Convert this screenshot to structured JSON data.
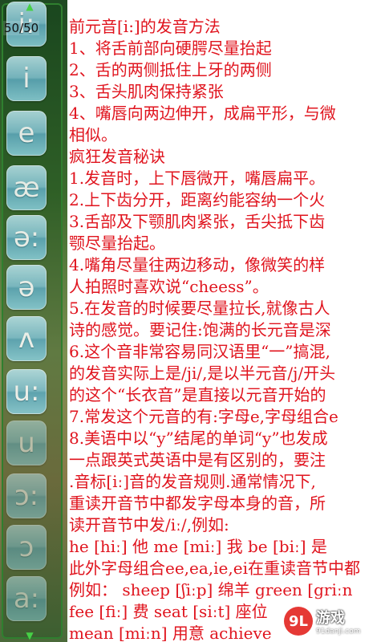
{
  "rail": {
    "counter": "50/50",
    "symbols": [
      "i:",
      "i",
      "e",
      "æ",
      "ə:",
      "ə",
      "ʌ",
      "u:",
      "u",
      "ɔ:",
      "ɔ",
      "a:"
    ]
  },
  "content": {
    "lines": [
      "前元音[i:]的发音方法",
      "1、将舌前部向硬腭尽量抬起",
      "2、舌的两侧抵住上牙的两侧",
      "3、舌头肌肉保持紧张",
      "4、嘴唇向两边伸开，成扁平形，与微",
      "相似。",
      "疯狂发音秘诀",
      "1.发音时，上下唇微开，嘴唇扁平。",
      "2.上下齿分开，距离约能容纳一个火",
      "3.舌部及下颚肌肉紧张，舌尖抵下齿",
      "颚尽量抬起。",
      "4.嘴角尽量往两边移动，像微笑的样",
      "人拍照时喜欢说“cheess”。",
      "5.在发音的时候要尽量拉长,就像古人",
      "诗的感觉。要记住:饱满的长元音是深",
      "6.这个音非常容易同汉语里“一”搞混,",
      "的发音实际上是/ji/,是以半元音/j/开头",
      "的这个“长衣音”是直接以元音开始的",
      "7.常发这个元音的有:字母e,字母组合e",
      "8.美语中以“y”结尾的单词“y”也发成",
      "一点跟英式英语中是有区别的，要注",
      ".音标[iː]音的发音规则.通常情况下,",
      "重读开音节中都发字母本身的音，所",
      "读开音节中发/iː/,例如:",
      "he [hiː] 他 me [miː] 我 be [biː] 是",
      "此外字母组合ee,ea,ie,ei在重读音节中都",
      "例如： sheep [ʃiːp] 绵羊 green [griːn",
      "fee [fiː] 费 seat [siːt] 座位",
      "mean [miːn] 用意 achieve"
    ]
  },
  "watermark": {
    "logo": "9L",
    "name": "游戏",
    "url": "91danji.com"
  }
}
